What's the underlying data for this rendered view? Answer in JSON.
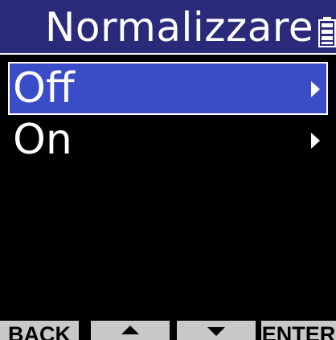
{
  "header": {
    "title": "Normalizzare",
    "battery_icon": "battery-icon",
    "background_color": "#2b2a7a"
  },
  "menu": {
    "items": [
      {
        "label": "Off",
        "selected": true,
        "arrow_icon": "chevron-right-icon"
      },
      {
        "label": "On",
        "selected": false,
        "arrow_icon": "chevron-right-icon"
      }
    ],
    "selected_color": "#3b4cc8"
  },
  "soft_keys": {
    "back_label": "BACK",
    "up_icon": "up-arrow-icon",
    "down_icon": "down-arrow-icon",
    "enter_label": "ENTER",
    "key_color": "#c8c8c8"
  }
}
